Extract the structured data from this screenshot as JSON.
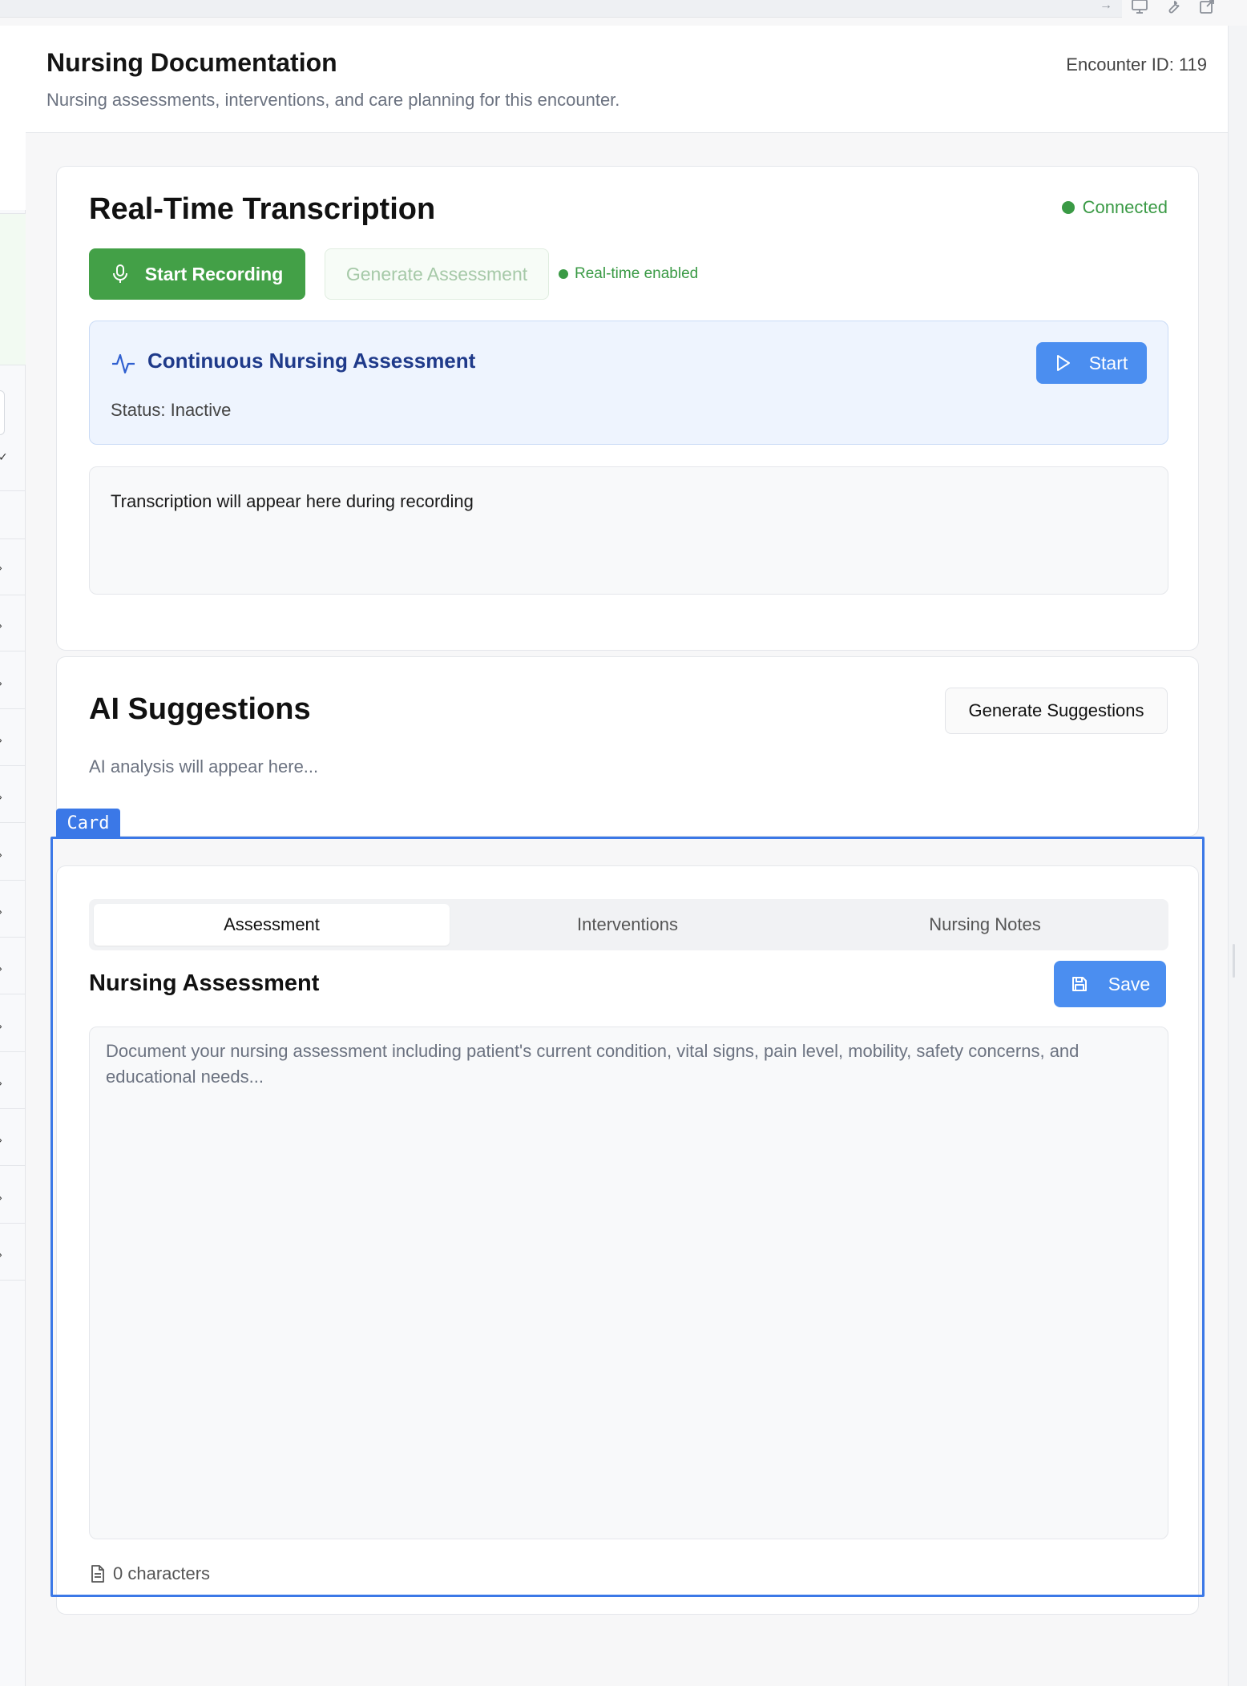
{
  "header": {
    "title": "Nursing Documentation",
    "subtitle": "Nursing assessments, interventions, and care planning for this encounter.",
    "encounter_id": "Encounter ID: 119"
  },
  "top_icons": [
    "arrow-right-icon",
    "monitor-icon",
    "wrench-icon",
    "external-edit-icon"
  ],
  "transcription": {
    "title": "Real-Time Transcription",
    "connection_status": "Connected",
    "start_recording_label": "Start Recording",
    "generate_assessment_label": "Generate Assessment",
    "realtime_label": "Real-time enabled",
    "continuous": {
      "title": "Continuous Nursing Assessment",
      "status": "Status: Inactive",
      "start_label": "Start"
    },
    "placeholder": "Transcription will appear here during recording"
  },
  "ai": {
    "title": "AI Suggestions",
    "generate_label": "Generate Suggestions",
    "placeholder": "AI analysis will appear here..."
  },
  "overlay": {
    "tag": "Card",
    "color": "#3b78e7"
  },
  "documentation": {
    "tabs": [
      {
        "label": "Assessment",
        "active": true
      },
      {
        "label": "Interventions",
        "active": false
      },
      {
        "label": "Nursing Notes",
        "active": false
      }
    ],
    "section_title": "Nursing Assessment",
    "save_label": "Save",
    "textarea_placeholder": "Document your nursing assessment including patient's current condition, vital signs, pain level, mobility, safety concerns, and educational needs...",
    "char_count": "0 characters"
  },
  "colors": {
    "green": "#43a047",
    "blue": "#4b8ef0",
    "connected": "#3a9a45"
  }
}
